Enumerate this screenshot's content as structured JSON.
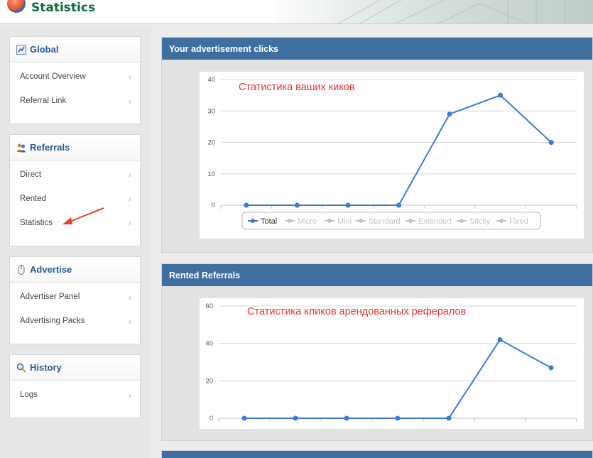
{
  "header": {
    "title": "Statistics"
  },
  "sidebar": {
    "panels": [
      {
        "title": "Global",
        "items": [
          "Account Overview",
          "Referral Link"
        ]
      },
      {
        "title": "Referrals",
        "items": [
          "Direct",
          "Rented",
          "Statistics"
        ]
      },
      {
        "title": "Advertise",
        "items": [
          "Advertiser Panel",
          "Advertising Packs"
        ]
      },
      {
        "title": "History",
        "items": [
          "Logs"
        ]
      }
    ]
  },
  "sections": [
    {
      "title": "Your advertisement clicks",
      "annotation": "Статистика ваших киков",
      "chart_data": {
        "type": "line",
        "x": [
          1,
          2,
          3,
          4,
          5,
          6,
          7
        ],
        "series": [
          {
            "name": "Total",
            "values": [
              0,
              0,
              0,
              0,
              29,
              35,
              20
            ]
          }
        ],
        "ylim": [
          0,
          40
        ],
        "yticks": [
          0,
          10,
          20,
          30,
          40
        ],
        "legend": [
          "Total",
          "Micro",
          "Mini",
          "Standard",
          "Extended",
          "Sticky",
          "Fixed"
        ],
        "legend_position": "bottom",
        "grid": true
      }
    },
    {
      "title": "Rented Referrals",
      "annotation": "Статистика кликов  арендованных рефералов",
      "chart_data": {
        "type": "line",
        "x": [
          1,
          2,
          3,
          4,
          5,
          6,
          7
        ],
        "series": [
          {
            "name": "",
            "values": [
              0,
              0,
              0,
              0,
              0,
              42,
              27
            ]
          }
        ],
        "ylim": [
          0,
          60
        ],
        "yticks": [
          0,
          20,
          40,
          60
        ],
        "grid": true
      }
    }
  ],
  "colors": {
    "accent": "#3f6fa1",
    "line": "#3a7bd5",
    "annotation": "#e8322e",
    "title": "#0e6b3e"
  }
}
